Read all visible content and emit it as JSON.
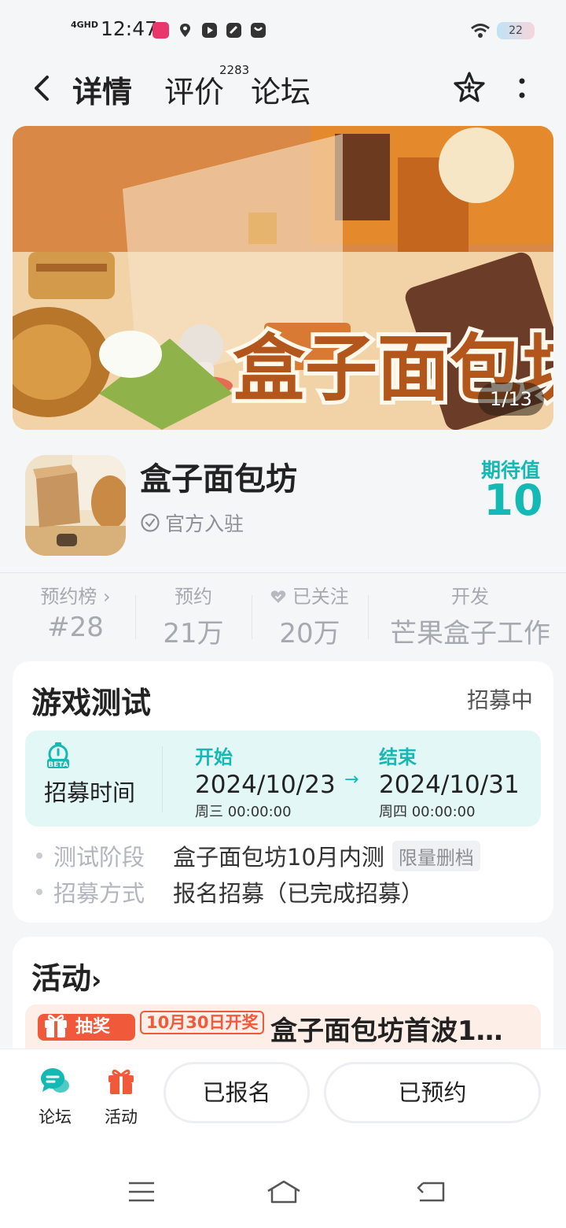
{
  "status_bar": {
    "network": "4GHD",
    "time": "12:47",
    "battery": "22"
  },
  "nav": {
    "tabs": [
      {
        "label": "详情"
      },
      {
        "label": "评价",
        "count": "2283"
      },
      {
        "label": "论坛"
      }
    ]
  },
  "banner": {
    "counter": "1/13"
  },
  "game": {
    "title": "盒子面包坊",
    "official_label": "官方入驻",
    "expect_label": "期待值",
    "expect_value": "10"
  },
  "stats": [
    {
      "label": "预约榜",
      "value": "#28"
    },
    {
      "label": "预约",
      "value": "21万"
    },
    {
      "label": "已关注",
      "value": "20万"
    },
    {
      "label": "开发",
      "value": "芒果盒子工作"
    }
  ],
  "test": {
    "title": "游戏测试",
    "status": "招募中",
    "time_label": "招募时间",
    "start_label": "开始",
    "start_date": "2024/10/23",
    "start_time": "周三  00:00:00",
    "end_label": "结束",
    "end_date": "2024/10/31",
    "end_time": "周四  00:00:00",
    "rows": [
      {
        "key": "测试阶段",
        "value": "盒子面包坊10月内测",
        "tag": "限量删档"
      },
      {
        "key": "招募方式",
        "value": "报名招募（已完成招募）"
      }
    ]
  },
  "activity": {
    "title": "活动",
    "tag": "抽奖",
    "date_tag": "10月30日开奖",
    "text": "盒子面包坊首波1…"
  },
  "bottom": {
    "forum_label": "论坛",
    "activity_label": "活动",
    "signed_label": "已报名",
    "reserved_label": "已预约"
  },
  "colors": {
    "accent": "#14b9b3",
    "lottery": "#f05a3b"
  }
}
